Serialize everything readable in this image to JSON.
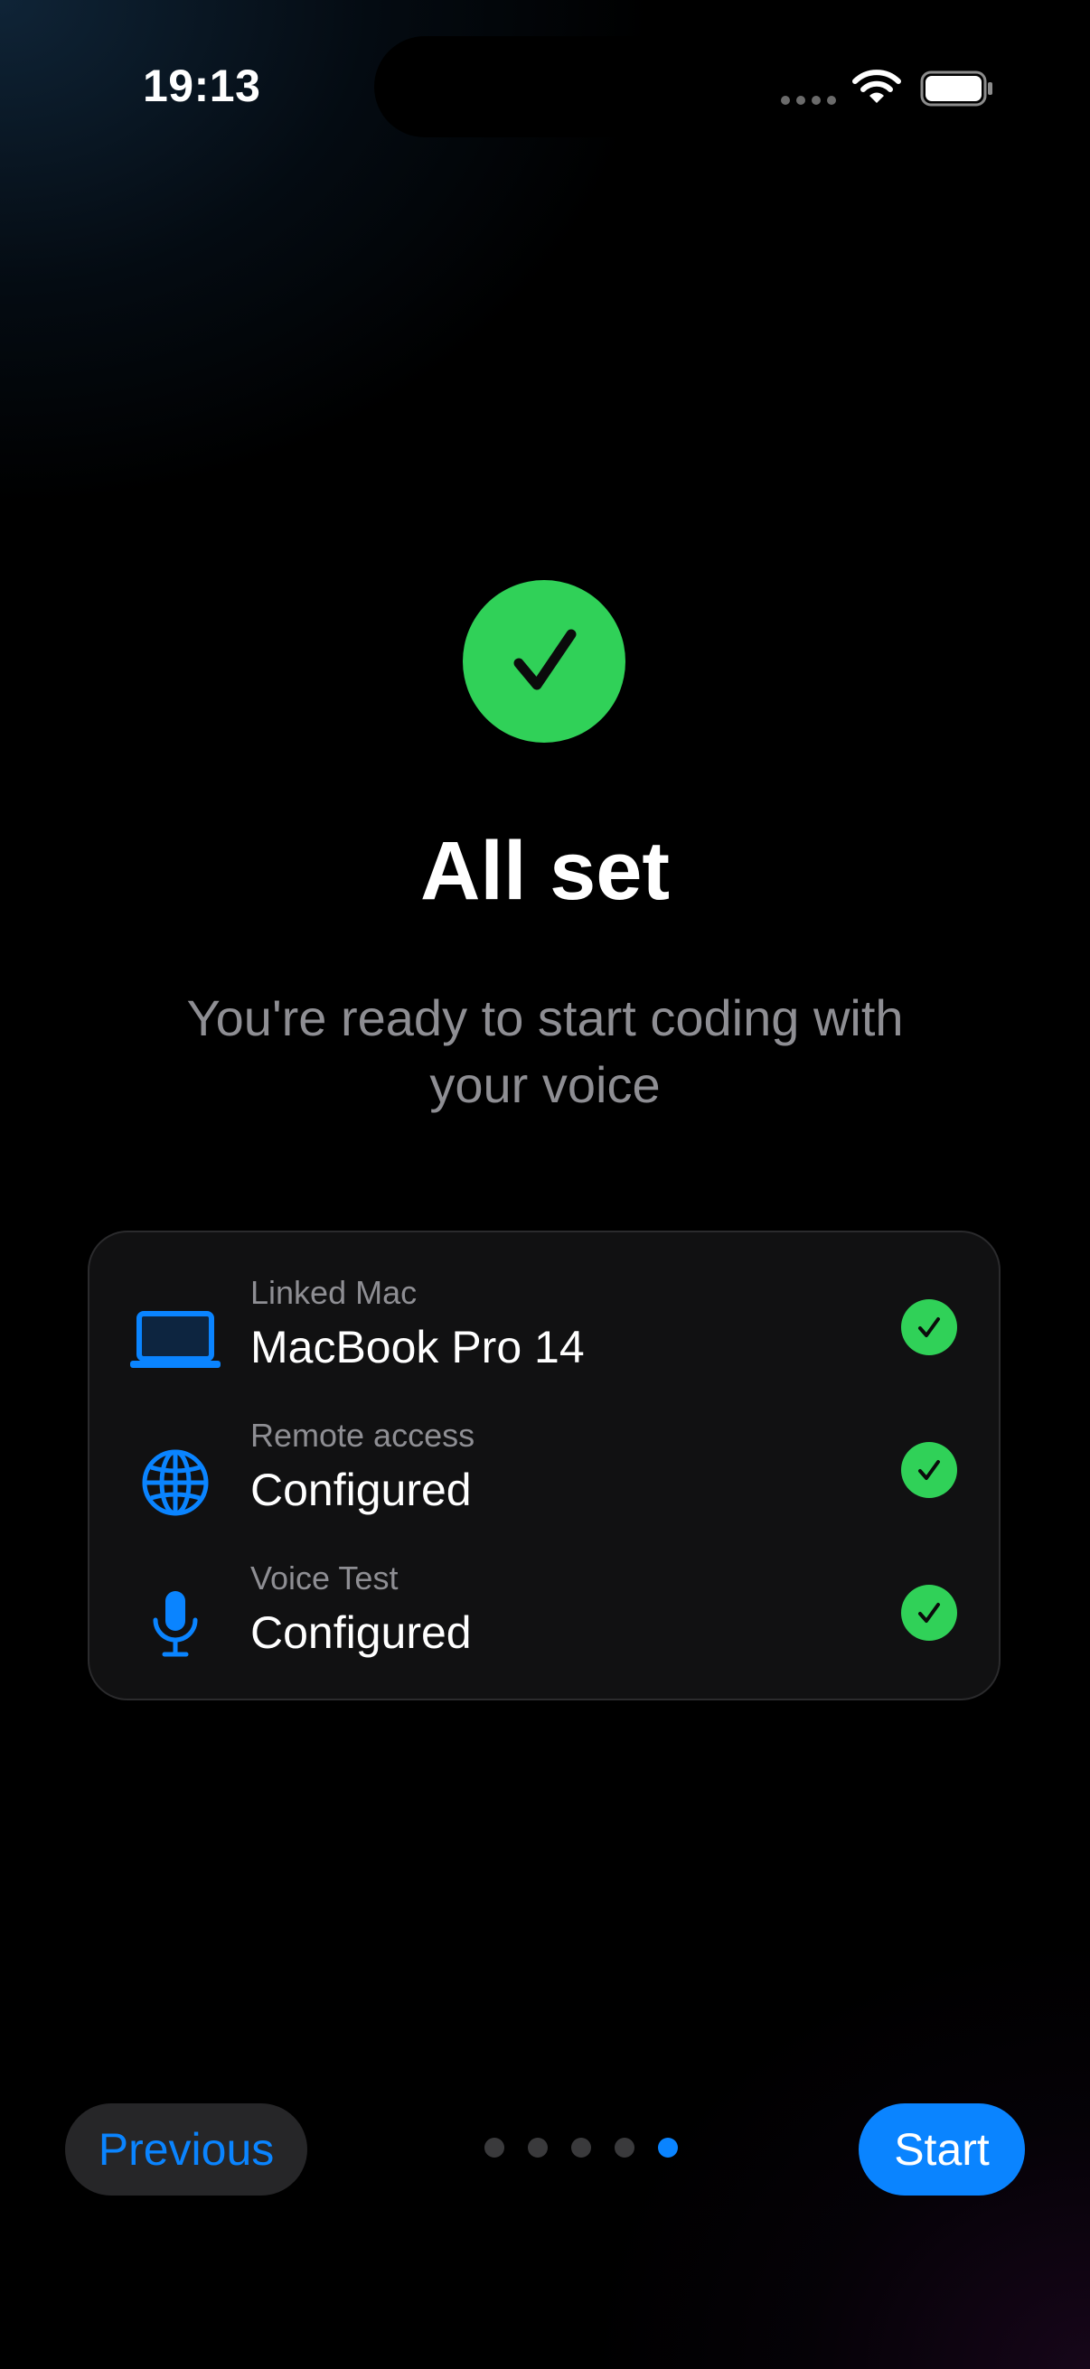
{
  "status_bar": {
    "time": "19:13"
  },
  "hero": {
    "title": "All set",
    "subtitle": "You're ready to start coding with your voice"
  },
  "summary": {
    "items": [
      {
        "label": "Linked Mac",
        "value": "MacBook Pro 14",
        "icon": "laptop-icon",
        "status": "checked"
      },
      {
        "label": "Remote access",
        "value": "Configured",
        "icon": "globe-icon",
        "status": "checked"
      },
      {
        "label": "Voice Test",
        "value": "Configured",
        "icon": "microphone-icon",
        "status": "checked"
      }
    ]
  },
  "navigation": {
    "previous_label": "Previous",
    "start_label": "Start",
    "page_count": 5,
    "current_page": 5
  },
  "colors": {
    "accent": "#0a84ff",
    "success": "#30d158",
    "secondary_text": "#8e8e93",
    "card_background": "#111112"
  }
}
